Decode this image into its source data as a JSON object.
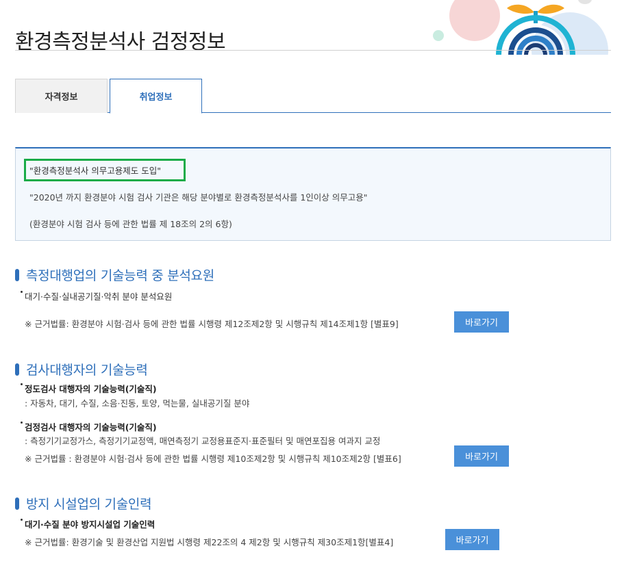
{
  "page_title": "환경측정분석사 검정정보",
  "tabs": [
    {
      "label": "자격정보",
      "active": false
    },
    {
      "label": "취업정보",
      "active": true
    }
  ],
  "notice": {
    "title": "\"환경측정분석사 의무고용제도 도입\"",
    "line1": "\"2020년 까지 환경분야 시험 검사 기관은 해당 분야별로 환경측정분석사를 1인이상 의무고용\"",
    "line2": "(환경분야 시험 검사 등에 관한 법률 제 18조의 2의 6항)"
  },
  "sections": [
    {
      "title": "측정대행업의 기술능력 중 분석요원",
      "bullet1": "대기·수질·실내공기질·악취 분야 분석요원",
      "basis": "※ 근거법률: 환경분야 시험·검사 등에 관한 법률 시행령 제12조제2항 및 시행규칙 제14조제1항 [별표9]",
      "button": "바로가기"
    },
    {
      "title": "검사대행자의 기술능력",
      "bullet1": "정도검사 대행자의 기술능력(기술직)",
      "sub1": ": 자동차, 대기, 수질, 소음·진동, 토양, 먹는물, 실내공기질 분야",
      "bullet2": "검정검사 대행자의 기술능력(기술직)",
      "sub2": ": 측정기기교정가스, 측정기기교정액, 매연측정기 교정용표준지·표준필터 및 매연포집용 여과지 교정",
      "basis": "※ 근거법률 : 환경분야 시험·검사 등에 관한 법률 시행령 제10조제2항 및 시행규칙 제10조제2항 [별표6]",
      "button": "바로가기"
    },
    {
      "title": "방지 시설업의 기술인력",
      "bullet1": "대기·수질 분야 방지시설업 기술인력",
      "basis": "※ 근거법률: 환경기술 및 환경산업 지원법 시행령 제22조의 4 제2항 및 시행규칙 제30조제1항[별표4]",
      "button": "바로가기"
    }
  ],
  "colors": {
    "accent": "#2e6fba",
    "button": "#4a90d9",
    "highlight_border": "#1aab48",
    "notice_bg": "#f3f8fd"
  }
}
